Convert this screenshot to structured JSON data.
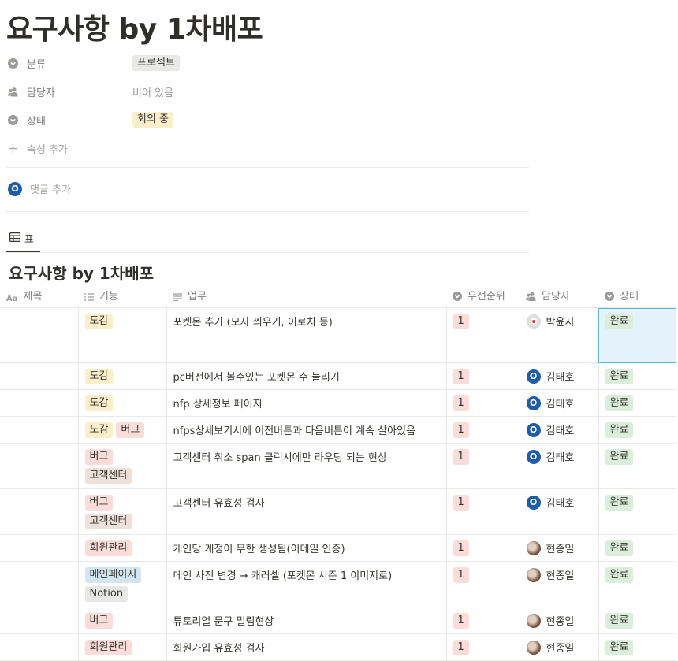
{
  "page": {
    "title": "요구사항 by 1차배포"
  },
  "properties": [
    {
      "name": "분류",
      "icon": "chevron-circle-icon",
      "value": "프로젝트",
      "tag_color": "gray"
    },
    {
      "name": "담당자",
      "icon": "people-icon",
      "value": "비어 있음",
      "empty": true
    },
    {
      "name": "상태",
      "icon": "chevron-circle-icon",
      "value": "회의 중",
      "tag_color": "yellow"
    }
  ],
  "add_property_label": "속성 추가",
  "comment": {
    "avatar_initial": "O",
    "label": "댓글 추가"
  },
  "view": {
    "tab_label": "표",
    "icon": "table-icon"
  },
  "database": {
    "title": "요구사항 by 1차배포",
    "columns": [
      {
        "label": "제목",
        "icon": "text-aa-icon"
      },
      {
        "label": "기능",
        "icon": "list-icon"
      },
      {
        "label": "업무",
        "icon": "text-lines-icon"
      },
      {
        "label": "우선순위",
        "icon": "chevron-circle-icon"
      },
      {
        "label": "담당자",
        "icon": "people-icon"
      },
      {
        "label": "상태",
        "icon": "chevron-circle-icon"
      }
    ],
    "rows": [
      {
        "title": "",
        "features": [
          {
            "text": "도감",
            "color": "yellow"
          }
        ],
        "task": "포켓몬 추가 (모자 씌우기, 이로치 등)",
        "priority": "1",
        "assignee": "박윤지",
        "avatar": "girl",
        "status": "완료"
      },
      {
        "title": "",
        "features": [
          {
            "text": "도감",
            "color": "yellow"
          }
        ],
        "task": "pc버전에서 볼수있는 포켓몬 수 늘리기",
        "priority": "1",
        "assignee": "김태호",
        "avatar": "initial",
        "status": "완료"
      },
      {
        "title": "",
        "features": [
          {
            "text": "도감",
            "color": "yellow"
          }
        ],
        "task": "nfp 상세정보 페이지",
        "priority": "1",
        "assignee": "김태호",
        "avatar": "initial",
        "status": "완료"
      },
      {
        "title": "",
        "features": [
          {
            "text": "도감",
            "color": "yellow"
          },
          {
            "text": "버그",
            "color": "red"
          }
        ],
        "task": "nfps상세보기시에 이전버튼과 다음버튼이 계속 살아있음",
        "priority": "1",
        "assignee": "김태호",
        "avatar": "initial",
        "status": "완료"
      },
      {
        "title": "",
        "features": [
          {
            "text": "버그",
            "color": "red"
          },
          {
            "text": "고객센터",
            "color": "brown"
          }
        ],
        "task": "고객센터 취소 span 클릭시에만 라우팅 되는 현상",
        "priority": "1",
        "assignee": "김태호",
        "avatar": "initial",
        "status": "완료"
      },
      {
        "title": "",
        "features": [
          {
            "text": "버그",
            "color": "red"
          },
          {
            "text": "고객센터",
            "color": "brown"
          }
        ],
        "task": "고객센터 유효성 검사",
        "priority": "1",
        "assignee": "김태호",
        "avatar": "initial",
        "status": "완료"
      },
      {
        "title": "",
        "features": [
          {
            "text": "회원관리",
            "color": "red"
          }
        ],
        "task": "개인당 계정이 무한 생성됨(이메일 인증)",
        "priority": "1",
        "assignee": "현종일",
        "avatar": "photo",
        "status": "완료"
      },
      {
        "title": "",
        "features": [
          {
            "text": "메인페이지",
            "color": "blue"
          },
          {
            "text": "Notion",
            "color": "gray"
          }
        ],
        "task": "메인 사진 변경 → 캐러셀 (포켓몬 시즌 1 이미지로)",
        "priority": "1",
        "assignee": "현종일",
        "avatar": "photo",
        "status": "완료"
      },
      {
        "title": "",
        "features": [
          {
            "text": "버그",
            "color": "red"
          }
        ],
        "task": "튜토리얼 문구 밀림현상",
        "priority": "1",
        "assignee": "현종일",
        "avatar": "photo",
        "status": "완료"
      },
      {
        "title": "",
        "features": [
          {
            "text": "회원관리",
            "color": "red"
          }
        ],
        "task": "회원가입 유효성 검사",
        "priority": "1",
        "assignee": "현종일",
        "avatar": "photo",
        "status": "완료"
      }
    ]
  }
}
